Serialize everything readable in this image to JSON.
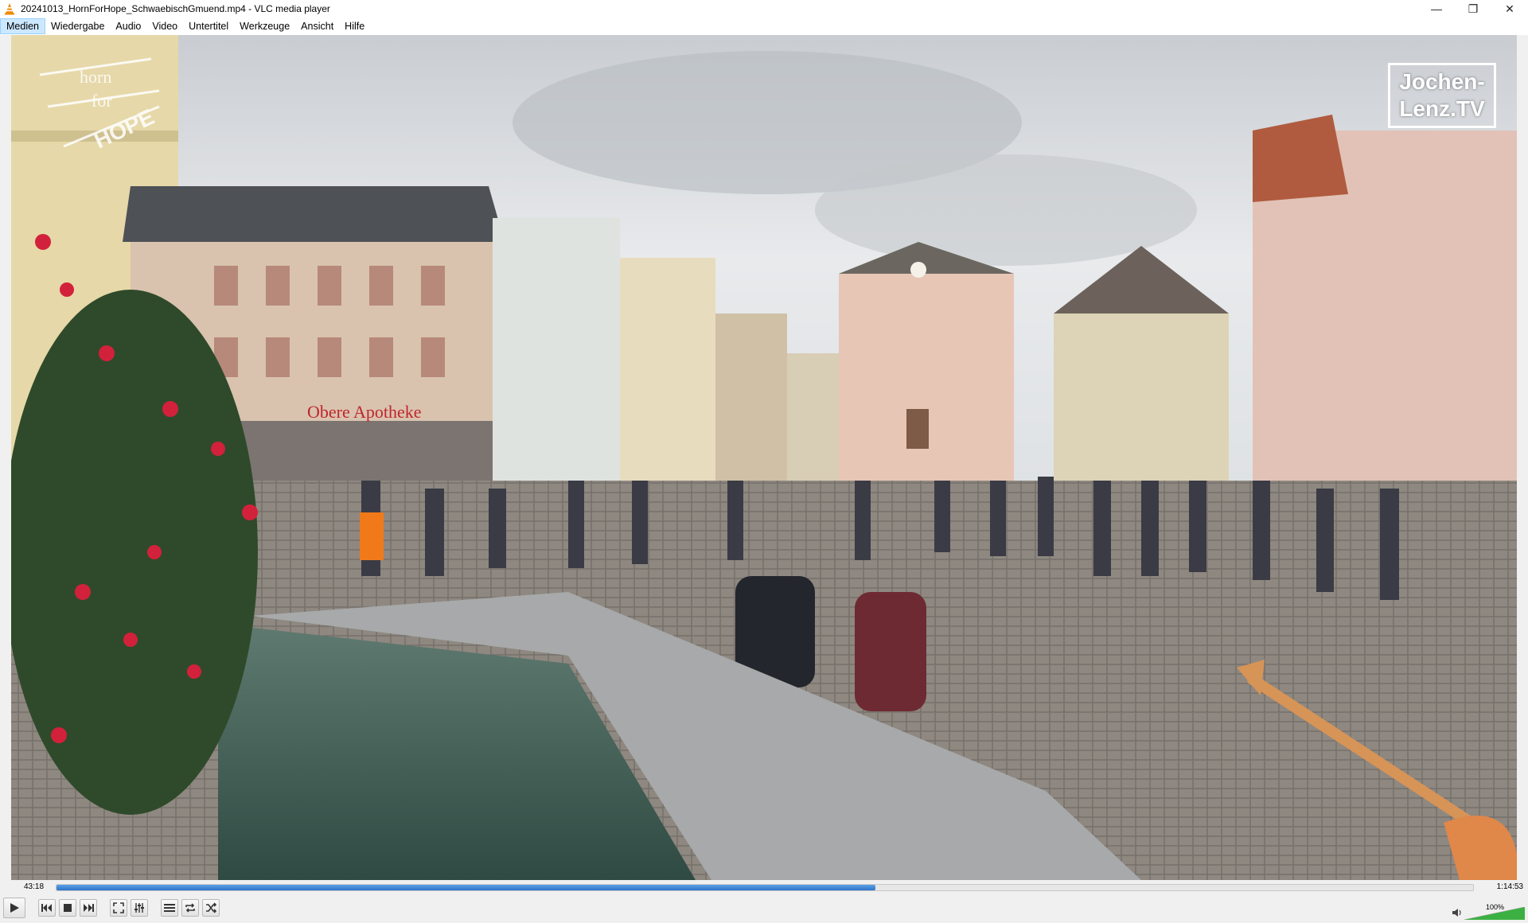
{
  "window": {
    "title": "20241013_HornForHope_SchwaebischGmuend.mp4 - VLC media player",
    "app_icon": "vlc-cone-icon",
    "controls": {
      "minimize": "—",
      "restore": "❐",
      "close": "✕"
    }
  },
  "menu": {
    "items": [
      {
        "label": "Medien",
        "active": true
      },
      {
        "label": "Wiedergabe",
        "active": false
      },
      {
        "label": "Audio",
        "active": false
      },
      {
        "label": "Video",
        "active": false
      },
      {
        "label": "Untertitel",
        "active": false
      },
      {
        "label": "Werkzeuge",
        "active": false
      },
      {
        "label": "Ansicht",
        "active": false
      },
      {
        "label": "Hilfe",
        "active": false
      }
    ]
  },
  "video": {
    "watermark_right": "Jochen-\nLenz.TV",
    "watermark_left_icon": "horn-for-hope-logo",
    "sign_text": "Obere Apotheke"
  },
  "playback": {
    "elapsed": "43:18",
    "total": "1:14:53",
    "progress_fraction": 0.578
  },
  "controls": {
    "buttons": [
      "play-icon",
      "previous-icon",
      "stop-icon",
      "next-icon",
      "fullscreen-icon",
      "extended-settings-icon",
      "playlist-icon",
      "loop-icon",
      "shuffle-icon"
    ]
  },
  "volume": {
    "label": "100%",
    "level_fraction": 1.0
  },
  "colors": {
    "accent": "#2f74c8",
    "volume": "#3cb043"
  }
}
